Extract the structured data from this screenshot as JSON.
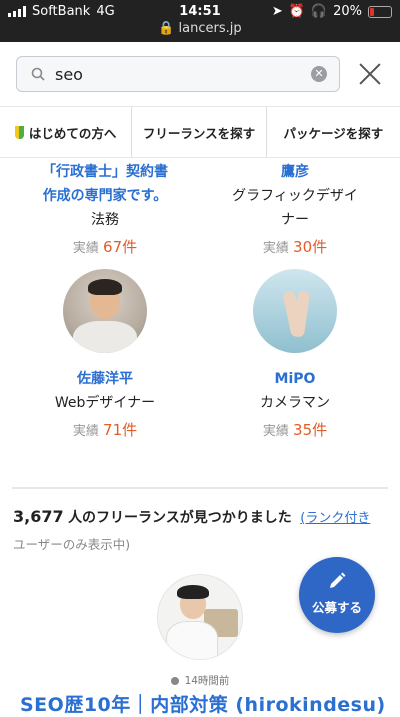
{
  "status_bar": {
    "carrier": "SoftBank",
    "network": "4G",
    "time": "14:51",
    "battery": "20%",
    "url": "lancers.jp"
  },
  "search": {
    "query": "seo"
  },
  "nav": {
    "items": [
      {
        "label": "はじめての方へ"
      },
      {
        "label": "フリーランスを探す"
      },
      {
        "label": "パッケージを探す"
      }
    ]
  },
  "freelancers": [
    {
      "name_line1": "「行政書士」契約書",
      "name_line2": "作成の専門家です。",
      "role": "法務",
      "stat_label": "実績",
      "stat_value": "67件"
    },
    {
      "name_line1": "鷹彦",
      "role_line1": "グラフィックデザイ",
      "role_line2": "ナー",
      "stat_label": "実績",
      "stat_value": "30件"
    },
    {
      "name": "佐藤洋平",
      "role": "Webデザイナー",
      "stat_label": "実績",
      "stat_value": "71件"
    },
    {
      "name": "MiPO",
      "role": "カメラマン",
      "stat_label": "実績",
      "stat_value": "35件"
    }
  ],
  "results": {
    "count": "3,677",
    "text": "人のフリーランスが見つかりました",
    "rank_link": "(ランク付き",
    "note": "ユーザーのみ表示中)"
  },
  "profile": {
    "last_seen": "14時間前",
    "headline": "SEO歴10年｜内部対策 (hirokindesu)"
  },
  "fab": {
    "label": "公募する"
  },
  "colors": {
    "link_blue": "#2a6fd1",
    "count_orange": "#e25c2a",
    "fab_blue": "#2f67c7"
  }
}
